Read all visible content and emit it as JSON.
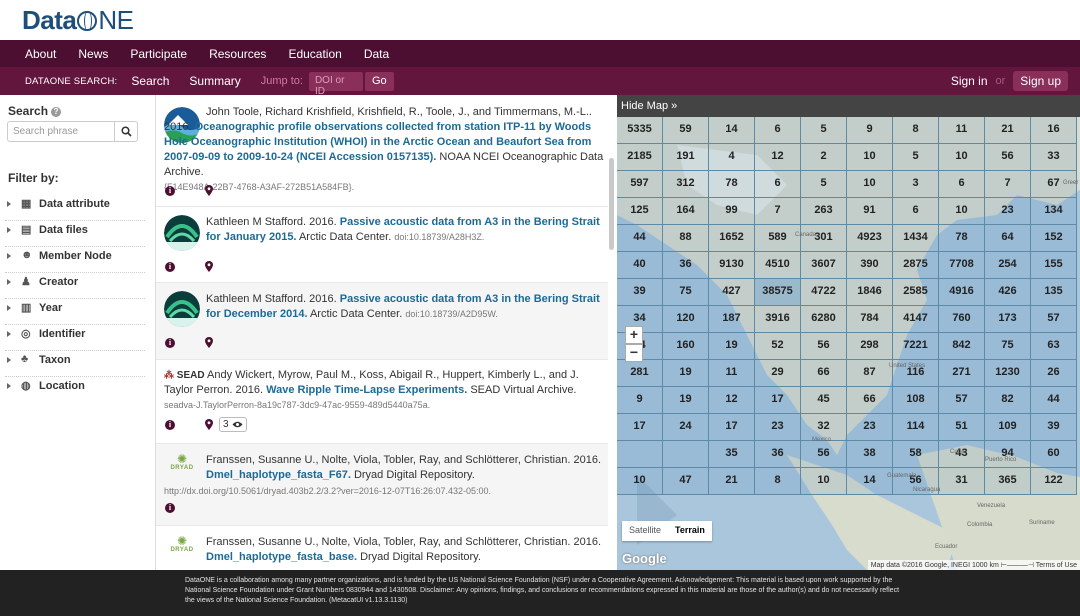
{
  "brand": {
    "name_bold": "Data",
    "name_tail": "NE"
  },
  "main_nav": [
    "About",
    "News",
    "Participate",
    "Resources",
    "Education",
    "Data"
  ],
  "sub_nav": {
    "label": "DATAONE SEARCH:",
    "links": [
      "Search",
      "Summary"
    ],
    "jump_label": "Jump to:",
    "doi_placeholder": "DOI or ID",
    "go_label": "Go",
    "signin": "Sign in",
    "or": "or",
    "signup": "Sign up"
  },
  "sidebar": {
    "search_title": "Search",
    "search_placeholder": "Search phrase",
    "filter_title": "Filter by:",
    "filters": [
      {
        "label": "Data attribute",
        "icon": "table-icon"
      },
      {
        "label": "Data files",
        "icon": "file-icon"
      },
      {
        "label": "Member Node",
        "icon": "users-icon"
      },
      {
        "label": "Creator",
        "icon": "user-icon"
      },
      {
        "label": "Year",
        "icon": "calendar-icon"
      },
      {
        "label": "Identifier",
        "icon": "fingerprint-icon"
      },
      {
        "label": "Taxon",
        "icon": "sitemap-icon"
      },
      {
        "label": "Location",
        "icon": "globe-icon"
      }
    ]
  },
  "results": [
    {
      "authors": "John Toole, Richard Krishfield, Krishfield, R., Toole, J., and Timmermans, M.-L.. 2016.",
      "title": "Oceanographic profile observations collected from station ITP-11 by Woods Hole Oceanographic Institution (WHOI) in the Arctic Ocean and Beaufort Sea from 2007-09-09 to 2009-10-24 (NCEI Accession 0157135).",
      "publisher": "NOAA NCEI Oceanographic Data Archive.",
      "id": "{F14E948A-22B7-4768-A3AF-272B51A584FB}."
    },
    {
      "authors": "Kathleen M Stafford. 2016.",
      "title": "Passive acoustic data from A3 in the Bering Strait for January 2015.",
      "publisher": "Arctic Data Center.",
      "id": "doi:10.18739/A28H3Z."
    },
    {
      "authors": "Kathleen M Stafford. 2016.",
      "title": "Passive acoustic data from A3 in the Bering Strait for December 2014.",
      "publisher": "Arctic Data Center.",
      "id": "doi:10.18739/A2D95W."
    },
    {
      "logo": "SEAD",
      "authors": "Andy Wickert, Myrow, Paul M., Koss, Abigail R., Huppert, Kimberly L., and J. Taylor Perron. 2016.",
      "title": "Wave Ripple Time-Lapse Experiments.",
      "publisher": "SEAD Virtual Archive.",
      "id": "seadva-J.TaylorPerron-8a19c787-3dc9-47ac-9559-489d5440a75a.",
      "count": "3"
    },
    {
      "logo": "DRYAD",
      "authors": "Franssen, Susanne U., Nolte, Viola, Tobler, Ray, and Schlötterer, Christian. 2016.",
      "title": "Dmel_haplotype_fasta_F67.",
      "publisher": "Dryad Digital Repository.",
      "id": "http://dx.doi.org/10.5061/dryad.403b2.2/3.2?ver=2016-12-07T16:26:07.432-05:00."
    },
    {
      "logo": "DRYAD",
      "authors": "Franssen, Susanne U., Nolte, Viola, Tobler, Ray, and Schlötterer, Christian. 2016.",
      "title": "Dmel_haplotype_fasta_base.",
      "publisher": "Dryad Digital Repository.",
      "id": ""
    }
  ],
  "map": {
    "hide_label": "Hide Map »",
    "grid": [
      [
        "5335",
        "59",
        "14",
        "6",
        "5",
        "9",
        "8",
        "11",
        "21",
        "16"
      ],
      [
        "2185",
        "191",
        "4",
        "12",
        "2",
        "10",
        "5",
        "10",
        "56",
        "33"
      ],
      [
        "597",
        "312",
        "78",
        "6",
        "5",
        "10",
        "3",
        "6",
        "7",
        "67"
      ],
      [
        "125",
        "164",
        "99",
        "7",
        "263",
        "91",
        "6",
        "10",
        "23",
        "134"
      ],
      [
        "44",
        "88",
        "1652",
        "589",
        "301",
        "4923",
        "1434",
        "78",
        "64",
        "152"
      ],
      [
        "40",
        "36",
        "9130",
        "4510",
        "3607",
        "390",
        "2875",
        "7708",
        "254",
        "155"
      ],
      [
        "39",
        "75",
        "427",
        "38575",
        "4722",
        "1846",
        "2585",
        "4916",
        "426",
        "135"
      ],
      [
        "34",
        "120",
        "187",
        "3916",
        "6280",
        "784",
        "4147",
        "760",
        "173",
        "57"
      ],
      [
        "84",
        "160",
        "19",
        "52",
        "56",
        "298",
        "7221",
        "842",
        "75",
        "63"
      ],
      [
        "281",
        "19",
        "11",
        "29",
        "66",
        "87",
        "116",
        "271",
        "1230",
        "26"
      ],
      [
        "9",
        "19",
        "12",
        "17",
        "45",
        "66",
        "108",
        "57",
        "82",
        "44"
      ],
      [
        "17",
        "24",
        "17",
        "23",
        "32",
        "23",
        "114",
        "51",
        "109",
        "39"
      ],
      [
        "",
        "",
        "35",
        "36",
        "56",
        "38",
        "58",
        "43",
        "94",
        "60"
      ],
      [
        "10",
        "47",
        "21",
        "8",
        "10",
        "14",
        "56",
        "31",
        "365",
        "122"
      ]
    ],
    "labels": {
      "canada": "Canada",
      "united_states": "United States",
      "mexico": "Mexico",
      "greenland": "Greer",
      "cuba": "Cuba",
      "guatemala": "Guatemala",
      "nicaragua": "Nicaragua",
      "venezuela": "Venezuela",
      "colombia": "Colombia",
      "suriname": "Suriname",
      "ecuador": "Ecuador",
      "puerto_rico": "Puerto Rico"
    },
    "zoom_in": "+",
    "zoom_out": "−",
    "map_types": [
      "Satellite",
      "Terrain"
    ],
    "google": "Google",
    "attribution": "Map data ©2016 Google, INEGI   1000 km ⊢———⊣   Terms of Use"
  },
  "footer": "DataONE is a collaboration among many partner organizations, and is funded by the US National Science Foundation (NSF) under a Cooperative Agreement. Acknowledgement: This material is based upon work supported by the National Science Foundation under Grant Numbers 0830944 and 1430508. Disclaimer: Any opinions, findings, and conclusions or recommendations expressed in this material are those of the author(s) and do not necessarily reflect the views of the National Science Foundation. (MetacatUI v1.13.3.1130)"
}
